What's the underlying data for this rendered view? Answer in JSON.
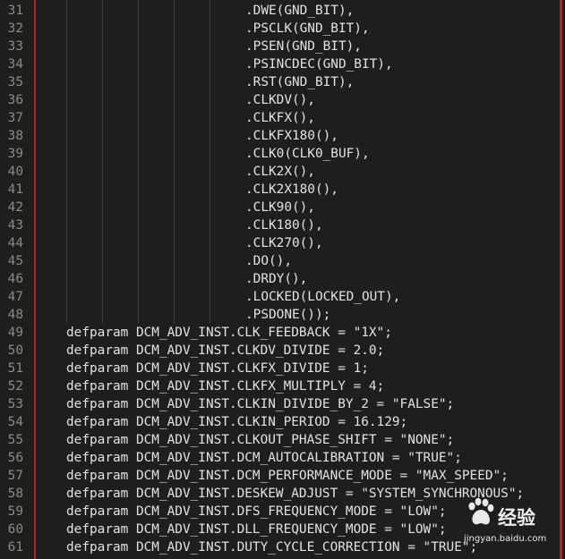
{
  "editor": {
    "lines": [
      {
        "no": "31",
        "text": ".DWE(GND_BIT),"
      },
      {
        "no": "32",
        "text": ".PSCLK(GND_BIT),"
      },
      {
        "no": "33",
        "text": ".PSEN(GND_BIT),"
      },
      {
        "no": "34",
        "text": ".PSINCDEC(GND_BIT),"
      },
      {
        "no": "35",
        "text": ".RST(GND_BIT),"
      },
      {
        "no": "36",
        "text": ".CLKDV(),"
      },
      {
        "no": "37",
        "text": ".CLKFX(),"
      },
      {
        "no": "38",
        "text": ".CLKFX180(),"
      },
      {
        "no": "39",
        "text": ".CLK0(CLK0_BUF),"
      },
      {
        "no": "40",
        "text": ".CLK2X(),"
      },
      {
        "no": "41",
        "text": ".CLK2X180(),"
      },
      {
        "no": "42",
        "text": ".CLK90(),"
      },
      {
        "no": "43",
        "text": ".CLK180(),"
      },
      {
        "no": "44",
        "text": ".CLK270(),"
      },
      {
        "no": "45",
        "text": ".DO(),"
      },
      {
        "no": "46",
        "text": ".DRDY(),"
      },
      {
        "no": "47",
        "text": ".LOCKED(LOCKED_OUT),"
      },
      {
        "no": "48",
        "text": ".PSDONE());"
      },
      {
        "no": "49",
        "text": "defparam DCM_ADV_INST.CLK_FEEDBACK = \"1X\";"
      },
      {
        "no": "50",
        "text": "defparam DCM_ADV_INST.CLKDV_DIVIDE = 2.0;"
      },
      {
        "no": "51",
        "text": "defparam DCM_ADV_INST.CLKFX_DIVIDE = 1;"
      },
      {
        "no": "52",
        "text": "defparam DCM_ADV_INST.CLKFX_MULTIPLY = 4;"
      },
      {
        "no": "53",
        "text": "defparam DCM_ADV_INST.CLKIN_DIVIDE_BY_2 = \"FALSE\";"
      },
      {
        "no": "54",
        "text": "defparam DCM_ADV_INST.CLKIN_PERIOD = 16.129;"
      },
      {
        "no": "55",
        "text": "defparam DCM_ADV_INST.CLKOUT_PHASE_SHIFT = \"NONE\";"
      },
      {
        "no": "56",
        "text": "defparam DCM_ADV_INST.DCM_AUTOCALIBRATION = \"TRUE\";"
      },
      {
        "no": "57",
        "text": "defparam DCM_ADV_INST.DCM_PERFORMANCE_MODE = \"MAX_SPEED\";"
      },
      {
        "no": "58",
        "text": "defparam DCM_ADV_INST.DESKEW_ADJUST = \"SYSTEM_SYNCHRONOUS\";"
      },
      {
        "no": "59",
        "text": "defparam DCM_ADV_INST.DFS_FREQUENCY_MODE = \"LOW\";"
      },
      {
        "no": "60",
        "text": "defparam DCM_ADV_INST.DLL_FREQUENCY_MODE = \"LOW\";"
      },
      {
        "no": "61",
        "text": "defparam DCM_ADV_INST.DUTY_CYCLE_CORRECTION = \"TRUE\";"
      }
    ]
  },
  "watermark": {
    "brand": "经验",
    "url": "jingyan.baidu.com",
    "icon": "baidu-paw-icon"
  },
  "colors": {
    "background": "#1e1e1e",
    "text": "#e2e2e2",
    "line_number": "#8a8a8a",
    "frame": "#c8191e"
  }
}
